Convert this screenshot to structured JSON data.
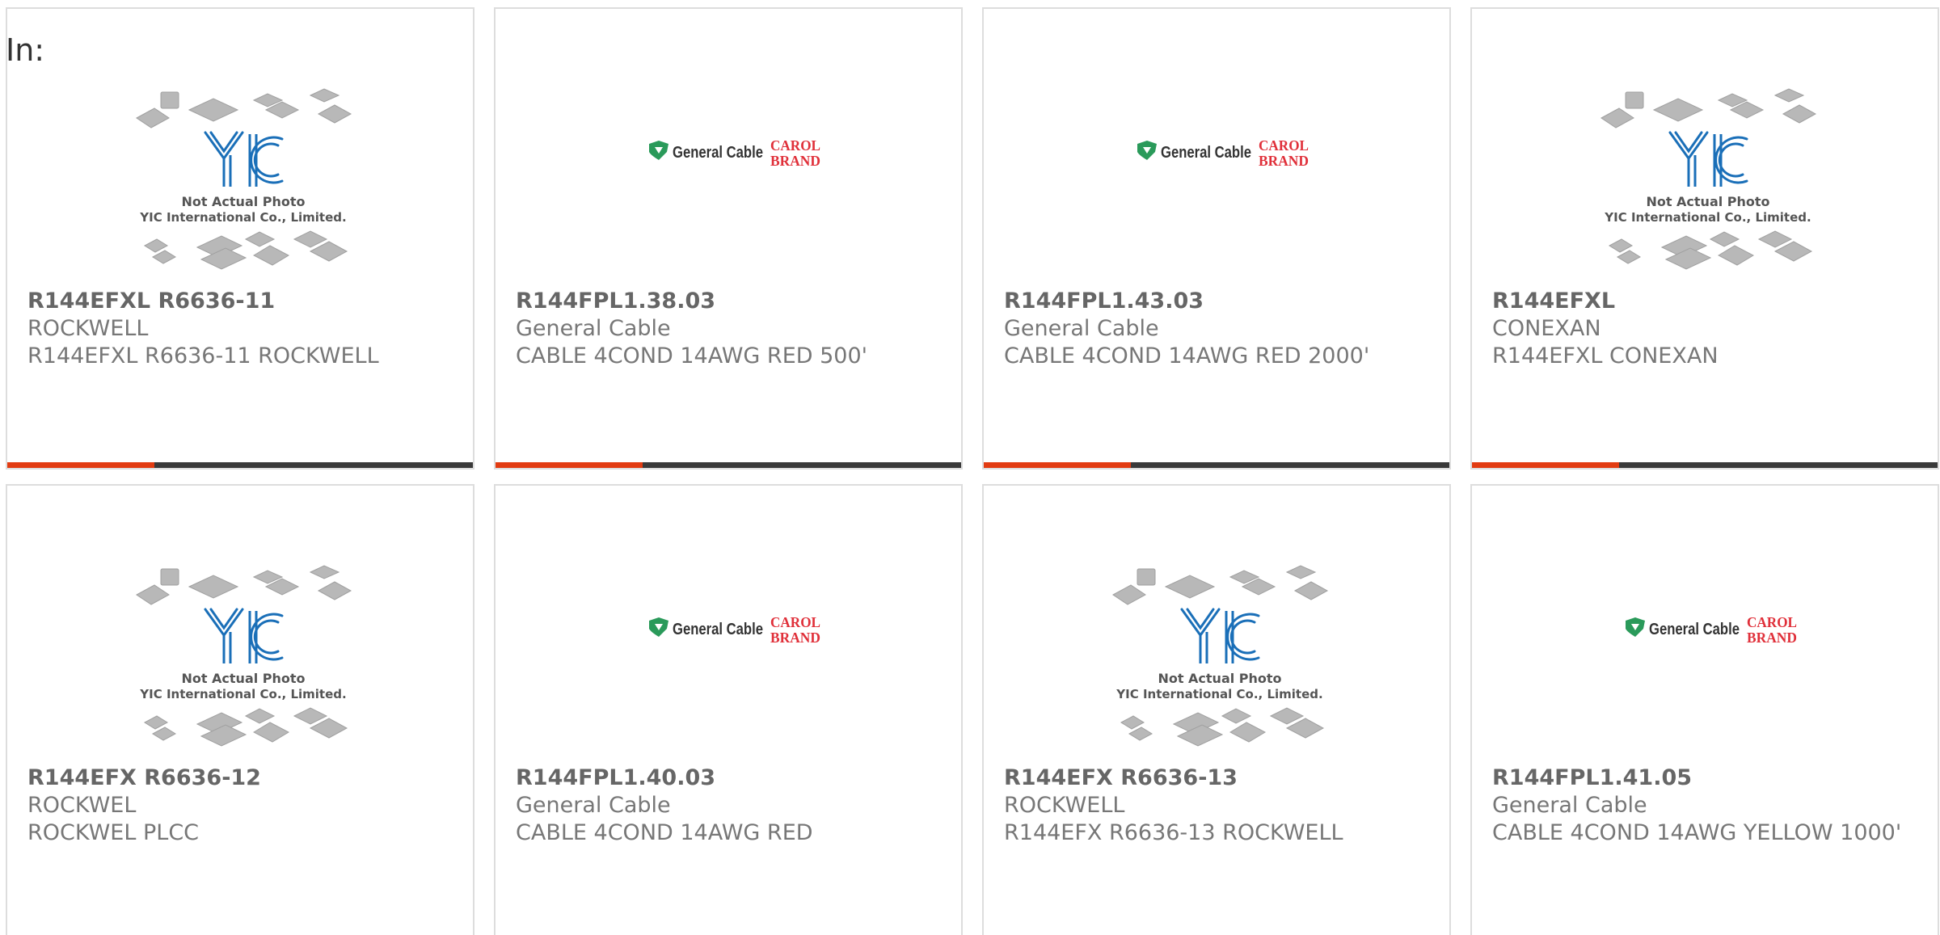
{
  "page": {
    "label": "In:"
  },
  "image_captions": {
    "yic_line1": "Not Actual Photo",
    "yic_line2": "YIC International Co., Limited.",
    "yic_logo": "YIC",
    "gc_brand": "General Cable",
    "carol_line1": "CAROL",
    "carol_line2": "BRAND"
  },
  "colors": {
    "accent": "#e23c12",
    "bar": "#3a3a3a",
    "border": "#dddddd",
    "yic_blue": "#1a6fb8",
    "gc_green": "#2a9a5a",
    "carol_red": "#e0303a"
  },
  "products": [
    {
      "part_number": "R144EFXL R6636-11",
      "manufacturer": "ROCKWELL",
      "description": "R144EFXL R6636-11 ROCKWELL",
      "image": "yic"
    },
    {
      "part_number": "R144FPL1.38.03",
      "manufacturer": "General Cable",
      "description": "CABLE 4COND 14AWG RED 500'",
      "image": "general-cable"
    },
    {
      "part_number": "R144FPL1.43.03",
      "manufacturer": "General Cable",
      "description": "CABLE 4COND 14AWG RED 2000'",
      "image": "general-cable"
    },
    {
      "part_number": "R144EFXL",
      "manufacturer": "CONEXAN",
      "description": "R144EFXL CONEXAN",
      "image": "yic"
    },
    {
      "part_number": "R144EFX R6636-12",
      "manufacturer": "ROCKWEL",
      "description": "ROCKWEL PLCC",
      "image": "yic"
    },
    {
      "part_number": "R144FPL1.40.03",
      "manufacturer": "General Cable",
      "description": "CABLE 4COND 14AWG RED",
      "image": "general-cable"
    },
    {
      "part_number": "R144EFX R6636-13",
      "manufacturer": "ROCKWELL",
      "description": "R144EFX R6636-13 ROCKWELL",
      "image": "yic"
    },
    {
      "part_number": "R144FPL1.41.05",
      "manufacturer": "General Cable",
      "description": "CABLE 4COND 14AWG YELLOW 1000'",
      "image": "general-cable"
    }
  ]
}
